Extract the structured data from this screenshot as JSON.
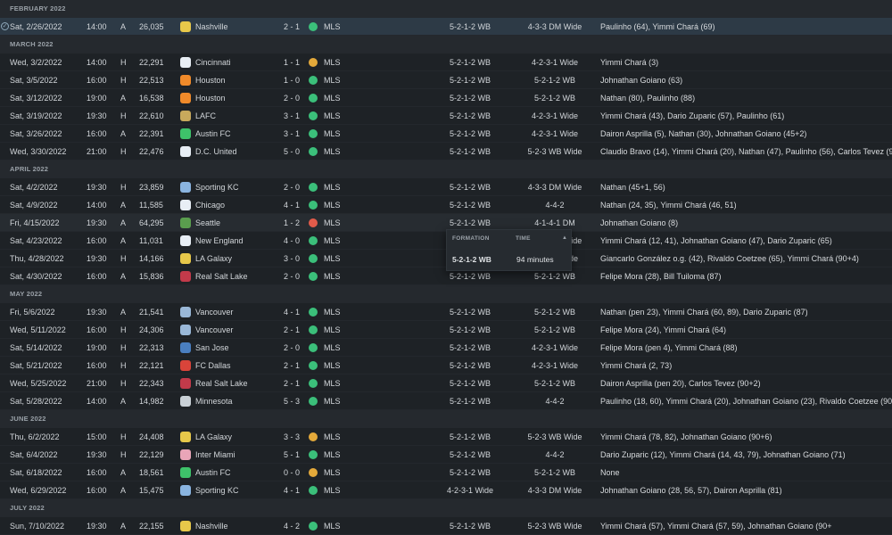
{
  "colors": {
    "win": "#3bbf7a",
    "draw": "#e4a93a",
    "loss": "#e25b4a",
    "selected_row": "#2d3a46",
    "background": "#1e2226"
  },
  "groups": [
    {
      "month": "FEBRUARY 2022",
      "matches": [
        {
          "date": "Sat, 2/26/2022",
          "time": "14:00",
          "venue": "A",
          "attendance": "26,035",
          "opponent": "Nashville",
          "crest": "#e7c84a",
          "score": "2 - 1",
          "result": "W",
          "competition": "MLS",
          "formation": "5-2-1-2 WB",
          "opp_formation": "4-3-3 DM Wide",
          "scorers": "Paulinho (64), Yimmi Chará (69)",
          "selected": true
        }
      ]
    },
    {
      "month": "MARCH 2022",
      "matches": [
        {
          "date": "Wed, 3/2/2022",
          "time": "14:00",
          "venue": "H",
          "attendance": "22,291",
          "opponent": "Cincinnati",
          "crest": "#e8eef5",
          "score": "1 - 1",
          "result": "D",
          "competition": "MLS",
          "formation": "5-2-1-2 WB",
          "opp_formation": "4-2-3-1 Wide",
          "scorers": "Yimmi Chará (3)"
        },
        {
          "date": "Sat, 3/5/2022",
          "time": "16:00",
          "venue": "H",
          "attendance": "22,513",
          "opponent": "Houston",
          "crest": "#f08a2a",
          "score": "1 - 0",
          "result": "W",
          "competition": "MLS",
          "formation": "5-2-1-2 WB",
          "opp_formation": "5-2-1-2 WB",
          "scorers": "Johnathan Goiano (63)"
        },
        {
          "date": "Sat, 3/12/2022",
          "time": "19:00",
          "venue": "A",
          "attendance": "16,538",
          "opponent": "Houston",
          "crest": "#f08a2a",
          "score": "2 - 0",
          "result": "W",
          "competition": "MLS",
          "formation": "5-2-1-2 WB",
          "opp_formation": "5-2-1-2 WB",
          "scorers": "Nathan (80), Paulinho (88)"
        },
        {
          "date": "Sat, 3/19/2022",
          "time": "19:30",
          "venue": "H",
          "attendance": "22,610",
          "opponent": "LAFC",
          "crest": "#c8a95c",
          "score": "3 - 1",
          "result": "W",
          "competition": "MLS",
          "formation": "5-2-1-2 WB",
          "opp_formation": "4-2-3-1 Wide",
          "scorers": "Yimmi Chará (43), Dario Zuparic (57), Paulinho (61)"
        },
        {
          "date": "Sat, 3/26/2022",
          "time": "16:00",
          "venue": "A",
          "attendance": "22,391",
          "opponent": "Austin FC",
          "crest": "#3ec26a",
          "score": "3 - 1",
          "result": "W",
          "competition": "MLS",
          "formation": "5-2-1-2 WB",
          "opp_formation": "4-2-3-1 Wide",
          "scorers": "Dairon Asprilla (5), Nathan (30), Johnathan Goiano (45+2)"
        },
        {
          "date": "Wed, 3/30/2022",
          "time": "21:00",
          "venue": "H",
          "attendance": "22,476",
          "opponent": "D.C. United",
          "crest": "#e8eef5",
          "score": "5 - 0",
          "result": "W",
          "competition": "MLS",
          "formation": "5-2-1-2 WB",
          "opp_formation": "5-2-3 WB Wide",
          "scorers": "Claudio Bravo (14), Yimmi Chará (20), Nathan (47), Paulinho (56), Carlos Tevez (9"
        }
      ]
    },
    {
      "month": "APRIL 2022",
      "matches": [
        {
          "date": "Sat, 4/2/2022",
          "time": "19:30",
          "venue": "H",
          "attendance": "23,859",
          "opponent": "Sporting KC",
          "crest": "#8ab4e0",
          "score": "2 - 0",
          "result": "W",
          "competition": "MLS",
          "formation": "5-2-1-2 WB",
          "opp_formation": "4-3-3 DM Wide",
          "scorers": "Nathan (45+1, 56)"
        },
        {
          "date": "Sat, 4/9/2022",
          "time": "14:00",
          "venue": "A",
          "attendance": "11,585",
          "opponent": "Chicago",
          "crest": "#e8eef5",
          "score": "4 - 1",
          "result": "W",
          "competition": "MLS",
          "formation": "5-2-1-2 WB",
          "opp_formation": "4-4-2",
          "scorers": "Nathan (24, 35), Yimmi Chará (46, 51)"
        },
        {
          "date": "Fri, 4/15/2022",
          "time": "19:30",
          "venue": "A",
          "attendance": "64,295",
          "opponent": "Seattle",
          "crest": "#5a9e4e",
          "score": "1 - 2",
          "result": "L",
          "competition": "MLS",
          "formation": "5-2-1-2 WB",
          "opp_formation": "4-1-4-1 DM",
          "scorers": "Johnathan Goiano (8)",
          "hover": true
        },
        {
          "date": "Sat, 4/23/2022",
          "time": "16:00",
          "venue": "A",
          "attendance": "11,031",
          "opponent": "New England",
          "crest": "#e8eef5",
          "score": "4 - 0",
          "result": "W",
          "competition": "MLS",
          "formation": "5-2-1-2 WB",
          "opp_formation": "4-3-3 DM Wide",
          "scorers": "Yimmi Chará (12, 41), Johnathan Goiano (47), Dario Zuparic (65)"
        },
        {
          "date": "Thu, 4/28/2022",
          "time": "19:30",
          "venue": "H",
          "attendance": "14,166",
          "opponent": "LA Galaxy",
          "crest": "#e7c84a",
          "score": "3 - 0",
          "result": "W",
          "competition": "MLS",
          "formation": "5-2-1-2 WB",
          "opp_formation": "4-2-3-1 Wide",
          "scorers": "Giancarlo González o.g. (42), Rivaldo Coetzee (65), Yimmi Chará (90+4)"
        },
        {
          "date": "Sat, 4/30/2022",
          "time": "16:00",
          "venue": "A",
          "attendance": "15,836",
          "opponent": "Real Salt Lake",
          "crest": "#c23a4a",
          "score": "2 - 0",
          "result": "W",
          "competition": "MLS",
          "formation": "5-2-1-2 WB",
          "opp_formation": "5-2-1-2 WB",
          "scorers": "Felipe Mora (28), Bill Tuiloma (87)"
        }
      ]
    },
    {
      "month": "MAY 2022",
      "matches": [
        {
          "date": "Fri, 5/6/2022",
          "time": "19:30",
          "venue": "A",
          "attendance": "21,541",
          "opponent": "Vancouver",
          "crest": "#9ab8d8",
          "score": "4 - 1",
          "result": "W",
          "competition": "MLS",
          "formation": "5-2-1-2 WB",
          "opp_formation": "5-2-1-2 WB",
          "scorers": "Nathan (pen 23), Yimmi Chará (60, 89), Dario Zuparic (87)"
        },
        {
          "date": "Wed, 5/11/2022",
          "time": "16:00",
          "venue": "H",
          "attendance": "24,306",
          "opponent": "Vancouver",
          "crest": "#9ab8d8",
          "score": "2 - 1",
          "result": "W",
          "competition": "MLS",
          "formation": "5-2-1-2 WB",
          "opp_formation": "5-2-1-2 WB",
          "scorers": "Felipe Mora (24), Yimmi Chará (64)"
        },
        {
          "date": "Sat, 5/14/2022",
          "time": "19:00",
          "venue": "H",
          "attendance": "22,313",
          "opponent": "San Jose",
          "crest": "#4a7fc0",
          "score": "2 - 0",
          "result": "W",
          "competition": "MLS",
          "formation": "5-2-1-2 WB",
          "opp_formation": "4-2-3-1 Wide",
          "scorers": "Felipe Mora (pen 4), Yimmi Chará (88)"
        },
        {
          "date": "Sat, 5/21/2022",
          "time": "16:00",
          "venue": "H",
          "attendance": "22,121",
          "opponent": "FC Dallas",
          "crest": "#d9443a",
          "score": "2 - 1",
          "result": "W",
          "competition": "MLS",
          "formation": "5-2-1-2 WB",
          "opp_formation": "4-2-3-1 Wide",
          "scorers": "Yimmi Chará (2, 73)"
        },
        {
          "date": "Wed, 5/25/2022",
          "time": "21:00",
          "venue": "H",
          "attendance": "22,343",
          "opponent": "Real Salt Lake",
          "crest": "#c23a4a",
          "score": "2 - 1",
          "result": "W",
          "competition": "MLS",
          "formation": "5-2-1-2 WB",
          "opp_formation": "5-2-1-2 WB",
          "scorers": "Dairon Asprilla (pen 20), Carlos Tevez (90+2)"
        },
        {
          "date": "Sat, 5/28/2022",
          "time": "14:00",
          "venue": "A",
          "attendance": "14,982",
          "opponent": "Minnesota",
          "crest": "#c9d0d6",
          "score": "5 - 3",
          "result": "W",
          "competition": "MLS",
          "formation": "5-2-1-2 WB",
          "opp_formation": "4-4-2",
          "scorers": "Paulinho (18, 60), Yimmi Chará (20), Johnathan Goiano (23), Rivaldo Coetzee (90+"
        }
      ]
    },
    {
      "month": "JUNE 2022",
      "matches": [
        {
          "date": "Thu, 6/2/2022",
          "time": "15:00",
          "venue": "H",
          "attendance": "24,408",
          "opponent": "LA Galaxy",
          "crest": "#e7c84a",
          "score": "3 - 3",
          "result": "D",
          "competition": "MLS",
          "formation": "5-2-1-2 WB",
          "opp_formation": "5-2-3 WB Wide",
          "scorers": "Yimmi Chará (78, 82), Johnathan Goiano (90+6)"
        },
        {
          "date": "Sat, 6/4/2022",
          "time": "19:30",
          "venue": "H",
          "attendance": "22,129",
          "opponent": "Inter Miami",
          "crest": "#e9a5b8",
          "score": "5 - 1",
          "result": "W",
          "competition": "MLS",
          "formation": "5-2-1-2 WB",
          "opp_formation": "4-4-2",
          "scorers": "Dario Zuparic (12), Yimmi Chará (14, 43, 79), Johnathan Goiano (71)"
        },
        {
          "date": "Sat, 6/18/2022",
          "time": "16:00",
          "venue": "A",
          "attendance": "18,561",
          "opponent": "Austin FC",
          "crest": "#3ec26a",
          "score": "0 - 0",
          "result": "D",
          "competition": "MLS",
          "formation": "5-2-1-2 WB",
          "opp_formation": "5-2-1-2 WB",
          "scorers": "None"
        },
        {
          "date": "Wed, 6/29/2022",
          "time": "16:00",
          "venue": "A",
          "attendance": "15,475",
          "opponent": "Sporting KC",
          "crest": "#8ab4e0",
          "score": "4 - 1",
          "result": "W",
          "competition": "MLS",
          "formation": "4-2-3-1 Wide",
          "opp_formation": "4-3-3 DM Wide",
          "scorers": "Johnathan Goiano (28, 56, 57), Dairon Asprilla (81)"
        }
      ]
    },
    {
      "month": "JULY 2022",
      "matches": [
        {
          "date": "Sun, 7/10/2022",
          "time": "19:30",
          "venue": "A",
          "attendance": "22,155",
          "opponent": "Nashville",
          "crest": "#e7c84a",
          "score": "4 - 2",
          "result": "W",
          "competition": "MLS",
          "formation": "5-2-1-2 WB",
          "opp_formation": "5-2-3 WB Wide",
          "scorers": "Yimmi Chará (57), Yimmi Chará (57, 59), Johnathan Goiano (90+"
        }
      ]
    }
  ],
  "tooltip": {
    "formation_header": "FORMATION",
    "time_header": "TIME",
    "sort_icon": "sort-up-icon",
    "formation": "5-2-1-2 WB",
    "time": "94 minutes"
  }
}
